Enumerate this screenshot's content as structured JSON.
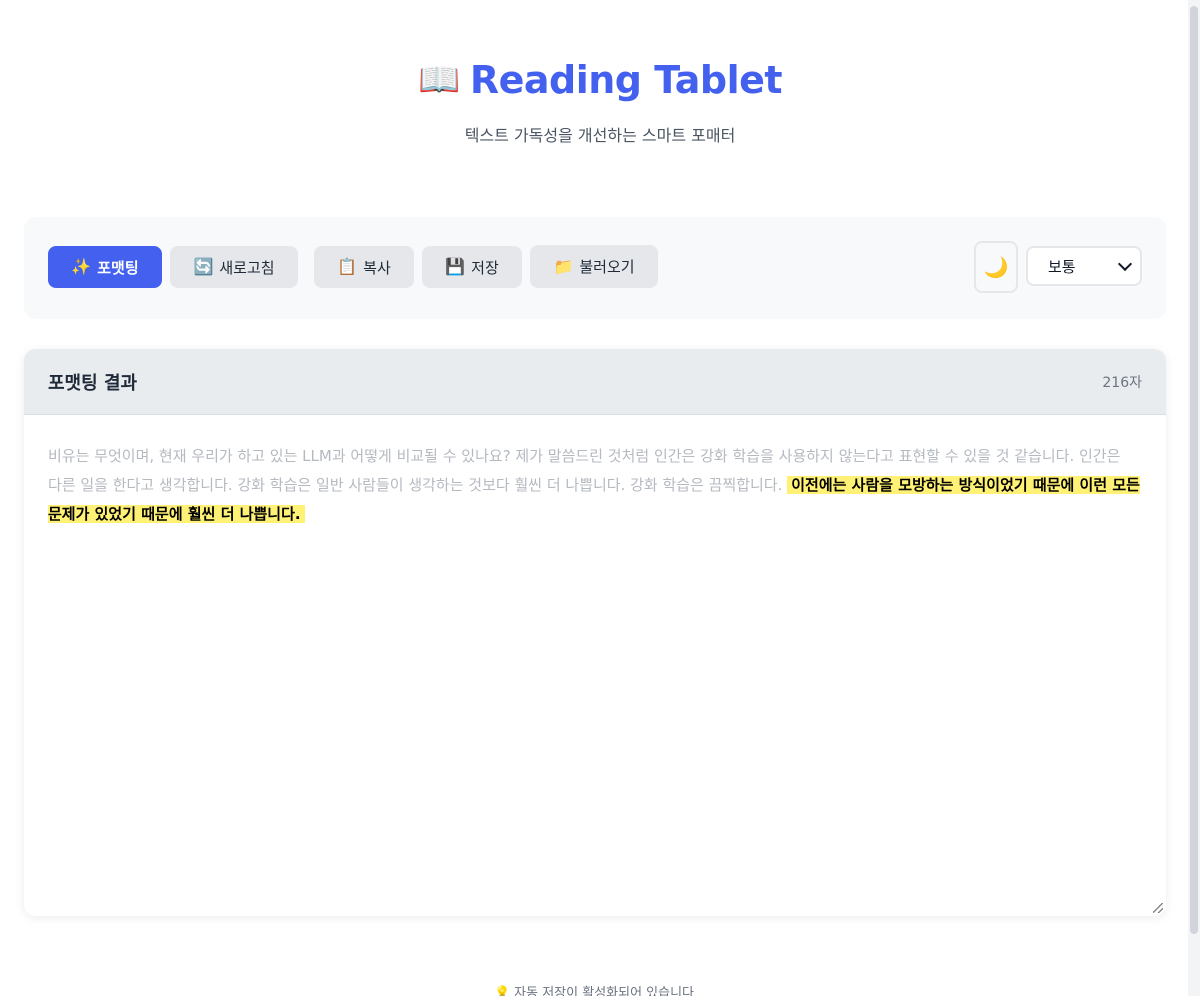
{
  "header": {
    "title_icon": "📖",
    "title": "Reading Tablet",
    "subtitle": "텍스트 가독성을 개선하는 스마트 포매터"
  },
  "toolbar": {
    "format": {
      "icon": "✨",
      "label": "포맷팅"
    },
    "refresh": {
      "icon": "🔄",
      "label": "새로고침"
    },
    "copy": {
      "icon": "📋",
      "label": "복사"
    },
    "save": {
      "icon": "💾",
      "label": "저장"
    },
    "load": {
      "icon": "📁",
      "label": "불러오기"
    },
    "theme_icon": "🌙",
    "font_size_select": {
      "selected": "보통"
    }
  },
  "result": {
    "title": "포맷팅 결과",
    "char_count": "216자",
    "text_faded": "비유는 무엇이며, 현재 우리가 하고 있는 LLM과 어떻게 비교될 수 있나요? 제가 말씀드린 것처럼 인간은 강화 학습을 사용하지 않는다고 표현할 수 있을 것 같습니다. 인간은 다른 일을 한다고 생각합니다. 강화 학습은 일반 사람들이 생각하는 것보다 훨씬 더 나쁩니다. 강화 학습은 끔찍합니다.",
    "text_highlighted": "이전에는 사람을 모방하는 방식이었기 때문에 이런 모든 문제가 있었기 때문에 훨씬 더 나쁩니다."
  },
  "footer": {
    "icon": "💡",
    "note": "자동 저장이 활성화되어 있습니다"
  },
  "colors": {
    "accent": "#4361ee",
    "highlight": "#fff176"
  }
}
